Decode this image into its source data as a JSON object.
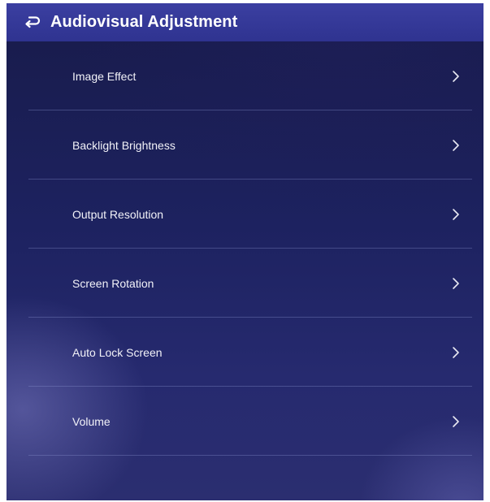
{
  "header": {
    "title": "Audiovisual Adjustment",
    "back_icon": "back-return-icon"
  },
  "menu": {
    "items": [
      {
        "label": "Image Effect",
        "icon": "chevron-right-icon"
      },
      {
        "label": "Backlight Brightness",
        "icon": "chevron-right-icon"
      },
      {
        "label": "Output Resolution",
        "icon": "chevron-right-icon"
      },
      {
        "label": "Screen Rotation",
        "icon": "chevron-right-icon"
      },
      {
        "label": "Auto Lock Screen",
        "icon": "chevron-right-icon"
      },
      {
        "label": "Volume",
        "icon": "chevron-right-icon"
      }
    ]
  },
  "colors": {
    "header_bg": "#3337a0",
    "screen_bg": "#1d2260",
    "text": "#ffffff",
    "divider": "#5a6096"
  }
}
